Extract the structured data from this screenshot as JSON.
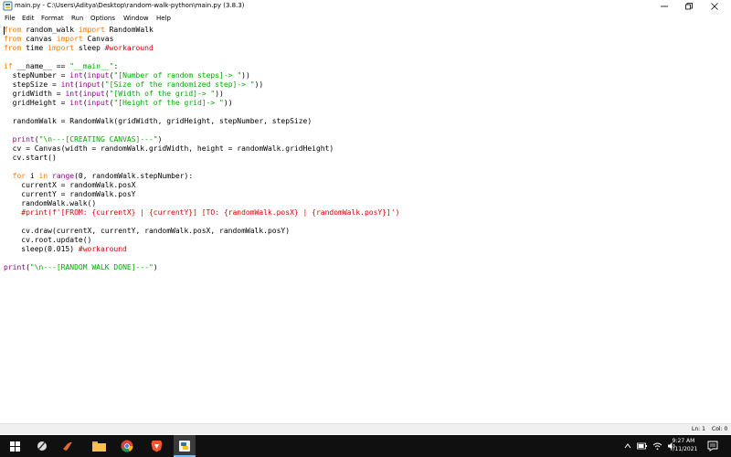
{
  "window": {
    "title": "main.py - C:\\Users\\Aditya\\Desktop\\random-walk-python\\main.py (3.8.3)"
  },
  "menu": {
    "items": [
      "File",
      "Edit",
      "Format",
      "Run",
      "Options",
      "Window",
      "Help"
    ]
  },
  "editor": {
    "lines": [
      [
        {
          "t": "from",
          "c": "kw"
        },
        {
          "t": " random_walk "
        },
        {
          "t": "import",
          "c": "kw"
        },
        {
          "t": " RandomWalk"
        }
      ],
      [
        {
          "t": "from",
          "c": "kw"
        },
        {
          "t": " canvas "
        },
        {
          "t": "import",
          "c": "kw"
        },
        {
          "t": " Canvas"
        }
      ],
      [
        {
          "t": "from",
          "c": "kw"
        },
        {
          "t": " time "
        },
        {
          "t": "import",
          "c": "kw"
        },
        {
          "t": " sleep "
        },
        {
          "t": "#workaround",
          "c": "cmt"
        }
      ],
      [],
      [
        {
          "t": "if",
          "c": "kw"
        },
        {
          "t": " __name__ == "
        },
        {
          "t": "\"__main__\"",
          "c": "str"
        },
        {
          "t": ":"
        }
      ],
      [
        {
          "t": "  stepNumber = "
        },
        {
          "t": "int",
          "c": "bi"
        },
        {
          "t": "("
        },
        {
          "t": "input",
          "c": "bi"
        },
        {
          "t": "("
        },
        {
          "t": "\"[Number of random steps]-> \"",
          "c": "str"
        },
        {
          "t": "))"
        }
      ],
      [
        {
          "t": "  stepSize = "
        },
        {
          "t": "int",
          "c": "bi"
        },
        {
          "t": "("
        },
        {
          "t": "input",
          "c": "bi"
        },
        {
          "t": "("
        },
        {
          "t": "\"[Size of the randomized step]-> \"",
          "c": "str"
        },
        {
          "t": "))"
        }
      ],
      [
        {
          "t": "  gridWidth = "
        },
        {
          "t": "int",
          "c": "bi"
        },
        {
          "t": "("
        },
        {
          "t": "input",
          "c": "bi"
        },
        {
          "t": "("
        },
        {
          "t": "\"[Width of the grid]-> \"",
          "c": "str"
        },
        {
          "t": "))"
        }
      ],
      [
        {
          "t": "  gridHeight = "
        },
        {
          "t": "int",
          "c": "bi"
        },
        {
          "t": "("
        },
        {
          "t": "input",
          "c": "bi"
        },
        {
          "t": "("
        },
        {
          "t": "\"[Height of the grid]-> \"",
          "c": "str"
        },
        {
          "t": "))"
        }
      ],
      [],
      [
        {
          "t": "  randomWalk = RandomWalk(gridWidth, gridHeight, stepNumber, stepSize)"
        }
      ],
      [],
      [
        {
          "t": "  "
        },
        {
          "t": "print",
          "c": "bi"
        },
        {
          "t": "("
        },
        {
          "t": "\"\\n---[CREATING CANVAS]---\"",
          "c": "str"
        },
        {
          "t": ")"
        }
      ],
      [
        {
          "t": "  cv = Canvas(width = randomWalk.gridWidth, height = randomWalk.gridHeight)"
        }
      ],
      [
        {
          "t": "  cv.start()"
        }
      ],
      [],
      [
        {
          "t": "  "
        },
        {
          "t": "for",
          "c": "kw"
        },
        {
          "t": " i "
        },
        {
          "t": "in",
          "c": "kw"
        },
        {
          "t": " "
        },
        {
          "t": "range",
          "c": "bi"
        },
        {
          "t": "(0, randomWalk.stepNumber):"
        }
      ],
      [
        {
          "t": "    currentX = randomWalk.posX"
        }
      ],
      [
        {
          "t": "    currentY = randomWalk.posY"
        }
      ],
      [
        {
          "t": "    randomWalk.walk()"
        }
      ],
      [
        {
          "t": "    "
        },
        {
          "t": "#print(f'[FROM: {currentX} | {currentY}] [TO: {randomWalk.posX} | {randomWalk.posY}]')",
          "c": "cmt"
        }
      ],
      [],
      [
        {
          "t": "    cv.draw(currentX, currentY, randomWalk.posX, randomWalk.posY)"
        }
      ],
      [
        {
          "t": "    cv.root.update()"
        }
      ],
      [
        {
          "t": "    sleep(0.015) "
        },
        {
          "t": "#workaround",
          "c": "cmt"
        }
      ],
      [],
      [
        {
          "t": "print",
          "c": "bi"
        },
        {
          "t": "("
        },
        {
          "t": "\"\\n---[RANDOM WALK DONE]---\"",
          "c": "str"
        },
        {
          "t": ")"
        }
      ]
    ]
  },
  "status": {
    "line": "Ln: 1",
    "col": "Col: 0"
  },
  "taskbar": {
    "apps": [
      "windows-start-icon",
      "search-icon",
      "python-idle-icon",
      "matlab-icon",
      "file-explorer-icon",
      "chrome-icon",
      "brave-icon",
      "mail-icon",
      "python-file-icon"
    ],
    "time": "9:27 AM",
    "date": "7/11/2021"
  }
}
